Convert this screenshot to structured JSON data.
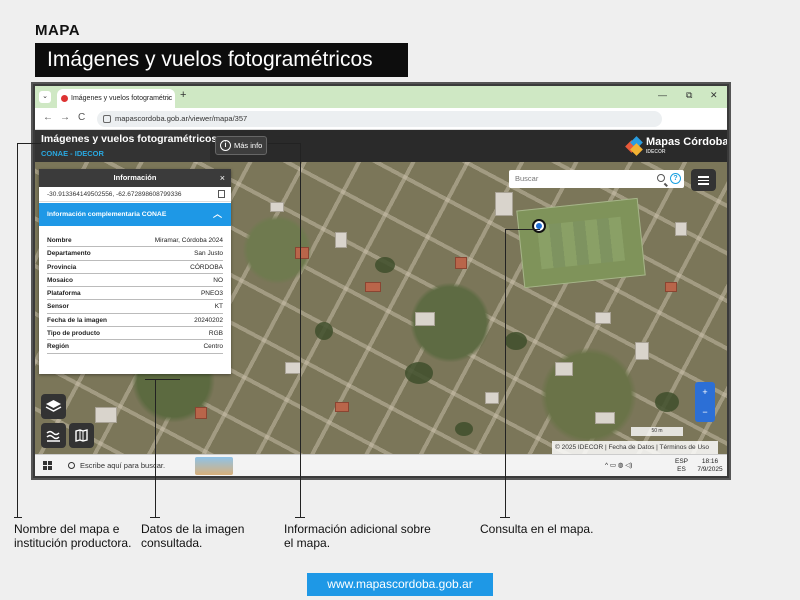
{
  "page": {
    "label": "MAPA",
    "title": "Imágenes y vuelos fotogramétricos",
    "footer_url": "www.mapascordoba.gob.ar"
  },
  "browser": {
    "tab_title": "Imágenes y vuelos fotogramétric",
    "tab_close": "×",
    "new_tab": "+",
    "url": "mapascordoba.gob.ar/viewer/mapa/357",
    "controls": {
      "minimize": "—",
      "restore": "⧉",
      "close": "✕"
    },
    "nav": {
      "back": "←",
      "forward": "→",
      "reload": "C"
    }
  },
  "app": {
    "title": "Imágenes y vuelos fotogramétricos",
    "subtitle": "CONAE - IDECOR",
    "more_info": "Más info",
    "info_glyph": "i",
    "logo_text": "Mapas Córdoba",
    "logo_sub": "IDECOR",
    "search_placeholder": "Buscar",
    "help_glyph": "?",
    "attribution": "© 2025 IDECOR | Fecha de Datos | Términos de Uso",
    "scale": "50 m",
    "zoom_in": "+",
    "zoom_out": "−"
  },
  "info_panel": {
    "header": "Información",
    "close": "×",
    "coords": "-30.913364149502556, -62.672898608799336",
    "section": "Información complementaria CONAE",
    "section_chevron": "︿",
    "rows": [
      {
        "key": "Nombre",
        "value": "Miramar, Córdoba 2024"
      },
      {
        "key": "Departamento",
        "value": "San Justo"
      },
      {
        "key": "Provincia",
        "value": "CÓRDOBA"
      },
      {
        "key": "Mosaico",
        "value": "NO"
      },
      {
        "key": "Plataforma",
        "value": "PNEO3"
      },
      {
        "key": "Sensor",
        "value": "KT"
      },
      {
        "key": "Fecha de la imagen",
        "value": "20240202"
      },
      {
        "key": "Tipo de producto",
        "value": "RGB"
      },
      {
        "key": "Región",
        "value": "Centro"
      }
    ]
  },
  "taskbar": {
    "search_text": "Escribe aquí para buscar.",
    "lang_top": "ESP",
    "lang_bottom": "ES",
    "time": "18:16",
    "date": "7/9/2025",
    "tray_icons": "^ ▭ ◍ ◁)"
  },
  "captions": {
    "map_name": "Nombre del mapa e institución productora.",
    "image_data": "Datos de la imagen consultada.",
    "extra_info": "Información adicional sobre el mapa.",
    "query": "Consulta en el mapa."
  },
  "colors": {
    "accent_blue": "#1e98e6",
    "title_bg": "#0d0d0d",
    "tab_bar_green": "#cfe8c4"
  },
  "icons": [
    "search-icon",
    "help-icon",
    "info-icon",
    "menu-icon",
    "layers-icon",
    "basemap-icon",
    "map-pin-icon",
    "copy-icon",
    "close-icon",
    "windows-logo-icon"
  ]
}
